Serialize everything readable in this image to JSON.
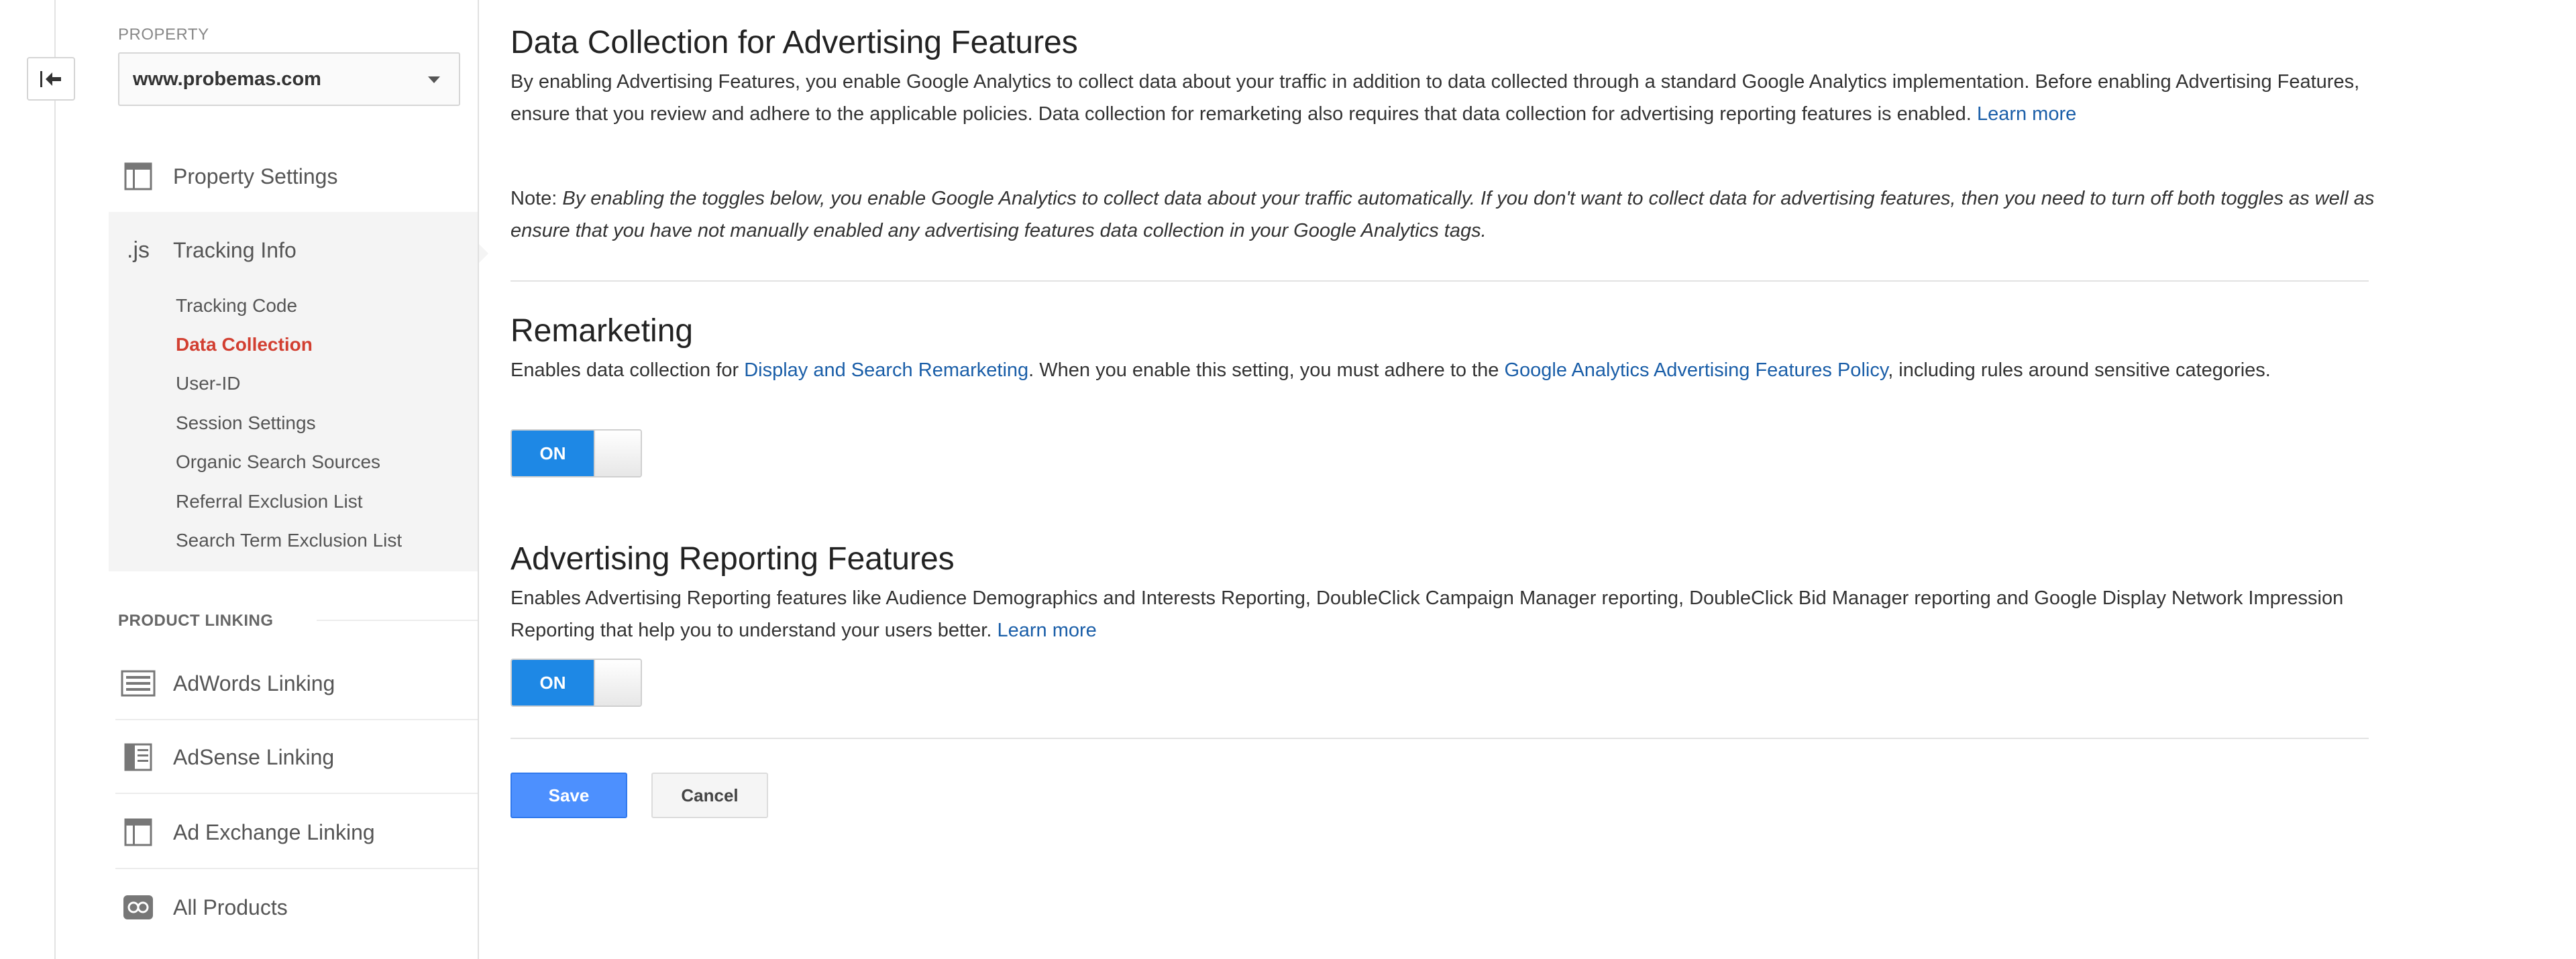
{
  "sidebar": {
    "property_label": "PROPERTY",
    "property_value": "www.probemas.com",
    "items": [
      {
        "label": "Property Settings",
        "icon": "window-icon"
      },
      {
        "label": "Tracking Info",
        "icon": "js-icon",
        "icon_text": ".js"
      }
    ],
    "tracking_subitems": [
      {
        "label": "Tracking Code"
      },
      {
        "label": "Data Collection",
        "active": true
      },
      {
        "label": "User-ID"
      },
      {
        "label": "Session Settings"
      },
      {
        "label": "Organic Search Sources"
      },
      {
        "label": "Referral Exclusion List"
      },
      {
        "label": "Search Term Exclusion List"
      }
    ],
    "product_linking_label": "PRODUCT LINKING",
    "product_links": [
      {
        "label": "AdWords Linking",
        "icon": "adwords-icon"
      },
      {
        "label": "AdSense Linking",
        "icon": "adsense-icon"
      },
      {
        "label": "Ad Exchange Linking",
        "icon": "ad-exchange-icon"
      },
      {
        "label": "All Products",
        "icon": "link-icon"
      }
    ]
  },
  "main": {
    "title": "Data Collection for Advertising Features",
    "intro_text": "By enabling Advertising Features, you enable Google Analytics to collect data about your traffic in addition to data collected through a standard Google Analytics implementation. Before enabling Advertising Features, ensure that you review and adhere to the applicable policies. Data collection for remarketing also requires that data collection for advertising reporting features is enabled.",
    "intro_link": "Learn more",
    "note_prefix": "Note:",
    "note_text": "By enabling the toggles below, you enable Google Analytics to collect data about your traffic automatically. If you don't want to collect data for advertising features, then you need to turn off both toggles as well as ensure that you have not manually enabled any advertising features data collection in your Google Analytics tags.",
    "remarketing": {
      "title": "Remarketing",
      "text_1": "Enables data collection for",
      "link_1": "Display and Search Remarketing",
      "text_2": ". When you enable this setting, you must adhere to the",
      "link_2": "Google Analytics Advertising Features Policy",
      "text_3": ", including rules around sensitive categories.",
      "toggle_label": "ON",
      "enabled": true
    },
    "advertising_reporting": {
      "title": "Advertising Reporting Features",
      "text": "Enables Advertising Reporting features like Audience Demographics and Interests Reporting, DoubleClick Campaign Manager reporting, DoubleClick Bid Manager reporting and Google Display Network Impression Reporting that help you to understand your users better.",
      "link": "Learn more",
      "toggle_label": "ON",
      "enabled": true
    },
    "save_label": "Save",
    "cancel_label": "Cancel"
  },
  "colors": {
    "accent_blue": "#1e88e5",
    "save_blue": "#4d90fe",
    "active_red": "#d23f31",
    "link_blue": "#1a5ea8"
  }
}
